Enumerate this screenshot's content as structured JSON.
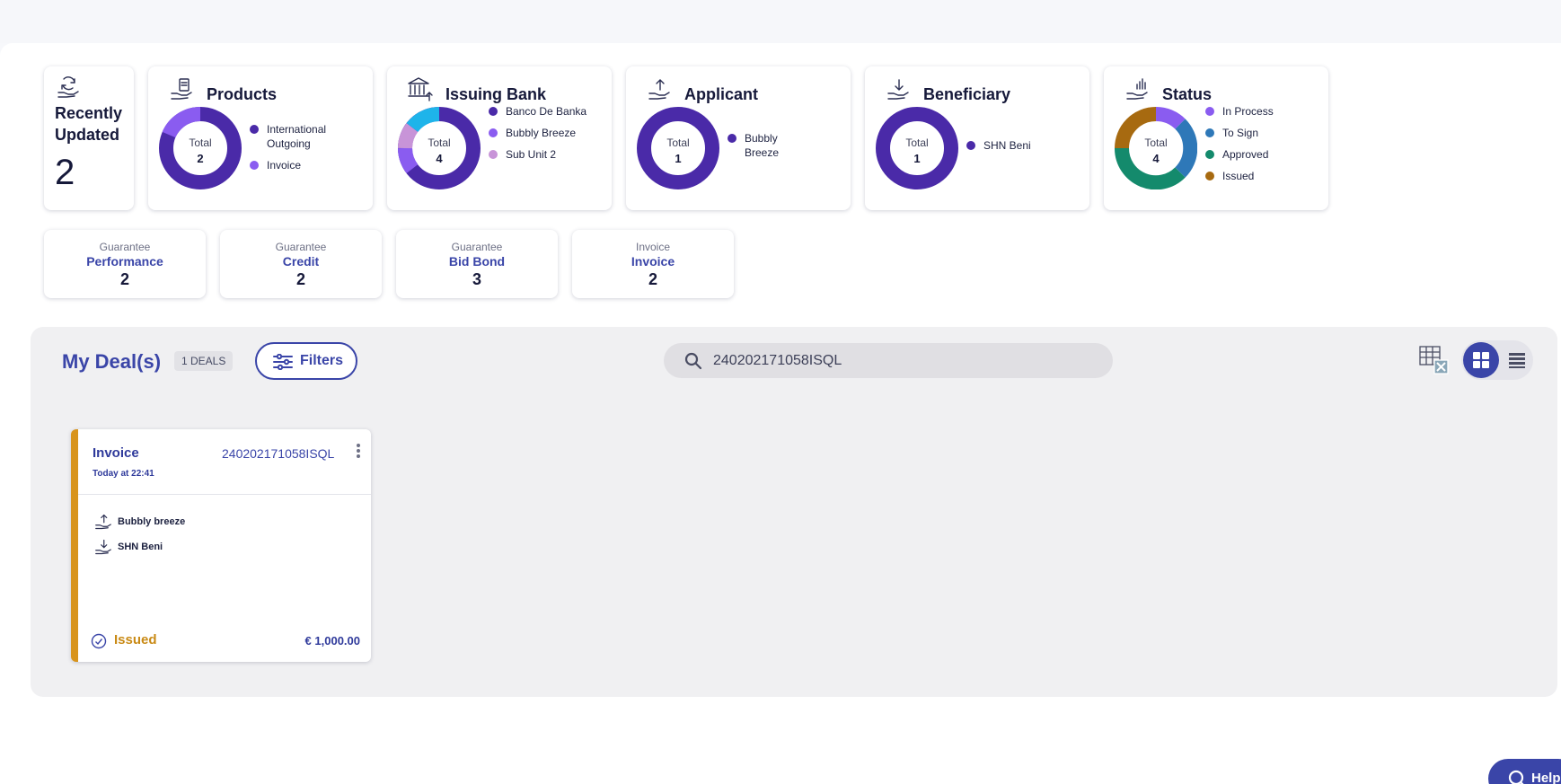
{
  "dashboard": {
    "recent": {
      "title": "Recently Updated",
      "count": "2",
      "icon": "refresh-hand-icon"
    },
    "products": {
      "title": "Products",
      "total_label": "Total",
      "total": "2",
      "icon": "product-hand-icon",
      "legend": [
        {
          "label": "International Outgoing",
          "color": "#4a2aa8"
        },
        {
          "label": "Invoice",
          "color": "#8a5cf0"
        }
      ]
    },
    "issuing_bank": {
      "title": "Issuing Bank",
      "total_label": "Total",
      "total": "4",
      "icon": "bank-icon",
      "legend": [
        {
          "label": "Banco De Banka",
          "color": "#4a2aa8"
        },
        {
          "label": "Bubbly Breeze",
          "color": "#8a5cf0"
        },
        {
          "label": "Sub Unit 2",
          "color": "#c894d8"
        }
      ]
    },
    "applicant": {
      "title": "Applicant",
      "total_label": "Total",
      "total": "1",
      "icon": "upload-hand-icon",
      "legend": [
        {
          "label": "Bubbly Breeze",
          "color": "#4a2aa8"
        }
      ]
    },
    "beneficiary": {
      "title": "Beneficiary",
      "total_label": "Total",
      "total": "1",
      "icon": "download-hand-icon",
      "legend": [
        {
          "label": "SHN Beni",
          "color": "#4a2aa8"
        }
      ]
    },
    "status": {
      "title": "Status",
      "total_label": "Total",
      "total": "4",
      "icon": "chart-hand-icon",
      "legend": [
        {
          "label": "In Process",
          "color": "#8a5cf0"
        },
        {
          "label": "To Sign",
          "color": "#2e78b8"
        },
        {
          "label": "Approved",
          "color": "#148a6c"
        },
        {
          "label": "Issued",
          "color": "#a76a10"
        }
      ]
    }
  },
  "summary": [
    {
      "category": "Guarantee",
      "name": "Performance",
      "count": "2"
    },
    {
      "category": "Guarantee",
      "name": "Credit",
      "count": "2"
    },
    {
      "category": "Guarantee",
      "name": "Bid Bond",
      "count": "3"
    },
    {
      "category": "Invoice",
      "name": "Invoice",
      "count": "2"
    }
  ],
  "deals": {
    "title": "My Deal(s)",
    "badge": "1 DEALS",
    "filters_label": "Filters",
    "search_value": "240202171058ISQL",
    "excel_icon": "excel-export-icon",
    "view_grid_icon": "grid-view-icon",
    "view_list_icon": "list-view-icon",
    "items": [
      {
        "type": "Invoice",
        "reference": "240202171058ISQL",
        "time": "Today at 22:41",
        "applicant": "Bubbly breeze",
        "beneficiary": "SHN Beni",
        "status": "Issued",
        "amount": "€ 1,000.00",
        "accent_color": "#d8941d"
      }
    ]
  },
  "help": {
    "label": "Help"
  }
}
